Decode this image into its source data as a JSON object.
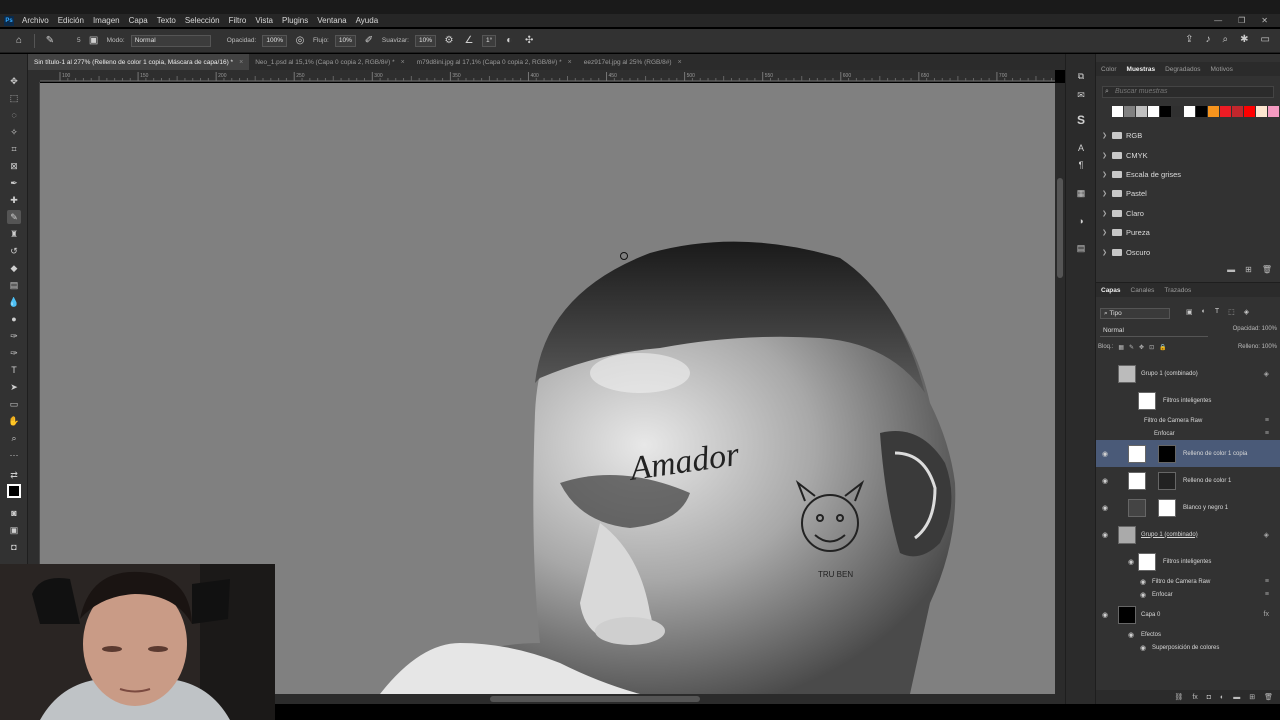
{
  "menubar": {
    "logo": "Ps",
    "items": [
      "Archivo",
      "Edición",
      "Imagen",
      "Capa",
      "Texto",
      "Selección",
      "Filtro",
      "Vista",
      "Plugins",
      "Ventana",
      "Ayuda"
    ]
  },
  "options": {
    "mode_label": "Modo:",
    "mode_value": "Normal",
    "opacity_label": "Opacidad:",
    "opacity_value": "100%",
    "flow_label": "Flujo:",
    "flow_value": "10%",
    "smooth_label": "Suavizar:",
    "smooth_value": "10%",
    "angle_value": "1°",
    "brush_size": "5"
  },
  "tabs": [
    {
      "label": "Sin título-1 al 277% (Relleno de color 1 copia, Máscara de capa/16) *"
    },
    {
      "label": "Neo_1.psd al 15,1% (Capa 0 copia 2, RGB/8#) *"
    },
    {
      "label": "m79d8ini.jpg al 17,1% (Capa 0 copia 2, RGB/8#) *"
    },
    {
      "label": "eez917el.jpg al 25% (RGB/8#)"
    }
  ],
  "swatches_panel": {
    "tabs": [
      "Color",
      "Muestras",
      "Degradados",
      "Motivos"
    ],
    "search_placeholder": "Buscar muestras",
    "colors": [
      "#ffffff",
      "#808080",
      "#c0c0c0",
      "#ffffff",
      "#000000",
      "#303030",
      "#ffffff",
      "#000000",
      "#f7941d",
      "#ed1c24",
      "#c1272d",
      "#ff0000",
      "#fde6d0",
      "#f49ac1",
      "#8560a8",
      "#2e3192",
      "#0072bc"
    ],
    "folders": [
      "RGB",
      "CMYK",
      "Escala de grises",
      "Pastel",
      "Claro",
      "Pureza",
      "Oscuro"
    ]
  },
  "layers_panel": {
    "tabs": [
      "Capas",
      "Canales",
      "Trazados"
    ],
    "filter": "Tipo",
    "blend": "Normal",
    "opacity_label": "Opacidad:",
    "opacity_value": "100%",
    "lock_label": "Bloq.:",
    "fill_label": "Relleno:",
    "fill_value": "100%",
    "layers": [
      {
        "name": "Grupo 1 (combinado)"
      },
      {
        "name": "Filtros inteligentes"
      },
      {
        "name": "Filtro de Camera Raw"
      },
      {
        "name": "Enfocar"
      },
      {
        "name": "Relleno de color 1 copia"
      },
      {
        "name": "Relleno de color 1"
      },
      {
        "name": "Blanco y negro 1"
      },
      {
        "name": "Grupo 1 (combinado)"
      },
      {
        "name": "Filtros inteligentes"
      },
      {
        "name": "Filtro de Camera Raw"
      },
      {
        "name": "Enfocar"
      },
      {
        "name": "Capa 0"
      },
      {
        "name": "Efectos"
      },
      {
        "name": "Superposición de colores"
      }
    ]
  },
  "canvas": {
    "tattoo_text": "Amador",
    "tattoo_small": "TRU BEN"
  },
  "ruler": {
    "top_ticks": [
      "100",
      "150",
      "200",
      "250",
      "300",
      "350",
      "400",
      "450",
      "500",
      "550",
      "600",
      "650",
      "700"
    ]
  }
}
